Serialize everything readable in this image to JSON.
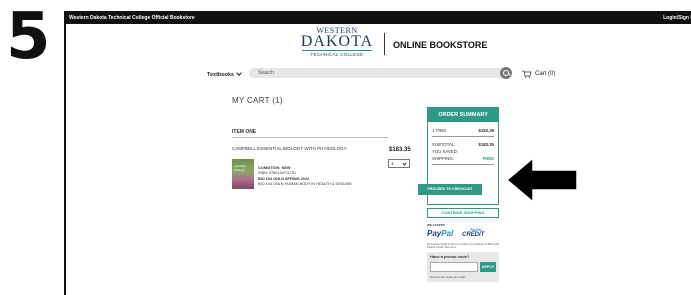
{
  "step_number": "5",
  "topbar": {
    "title": "Western Dakota Technical College Official Bookstore",
    "login": "Login/Sign Up"
  },
  "logo": {
    "line1": "WESTERN",
    "line2": "DAKOTA",
    "line3": "TECHNICAL COLLEGE"
  },
  "store_name": "ONLINE BOOKSTORE",
  "nav": {
    "textbooks": "Textbooks",
    "search_placeholder": "Search",
    "cart": "Cart (0)"
  },
  "cart": {
    "heading": "MY CART (1)",
    "item_label": "ITEM ONE",
    "item": {
      "title": "CAMPBELL ESSENTIAL BIOLOGY WITH PHYSIOLOGY",
      "price": "$183.35",
      "quantity": "1",
      "cover_text": "essential biology",
      "condition": "CONDITION: NEW",
      "isbn": "ISBN: 9780134711751",
      "course": "BIO 104 ONLN  SPRING 2022",
      "course_desc": "BIO 104 ONLN HUMAN BODY IN HEALTH & DISEASE"
    }
  },
  "summary": {
    "heading": "ORDER SUMMARY",
    "item_count": "1 ITEM",
    "item_total": "$183.35",
    "subtotal_label": "SUBTOTAL:",
    "subtotal": "$183.35",
    "saved_label": "YOU SAVED:",
    "shipping_label": "SHIPPING:",
    "shipping": "FREE",
    "checkout_button": "PROCEED TO CHECKOUT",
    "continue_button": "CONTINUE SHOPPING"
  },
  "payment": {
    "we_accept": "WE ACCEPT",
    "paypal_1": "Pay",
    "paypal_2": "Pal",
    "paypal_credit_small": "PayPal",
    "paypal_credit": "CREDIT",
    "fine_print": "No interest if paid in full in 6 months on purchases of $99+ with PayPal Credit. See terms."
  },
  "promo": {
    "question": "Have a promo code?",
    "apply": "APPLY",
    "note": "One promo code per order"
  },
  "colors": {
    "accent": "#2e9a86",
    "topbar": "#111111",
    "logo": "#1f3a5f"
  }
}
